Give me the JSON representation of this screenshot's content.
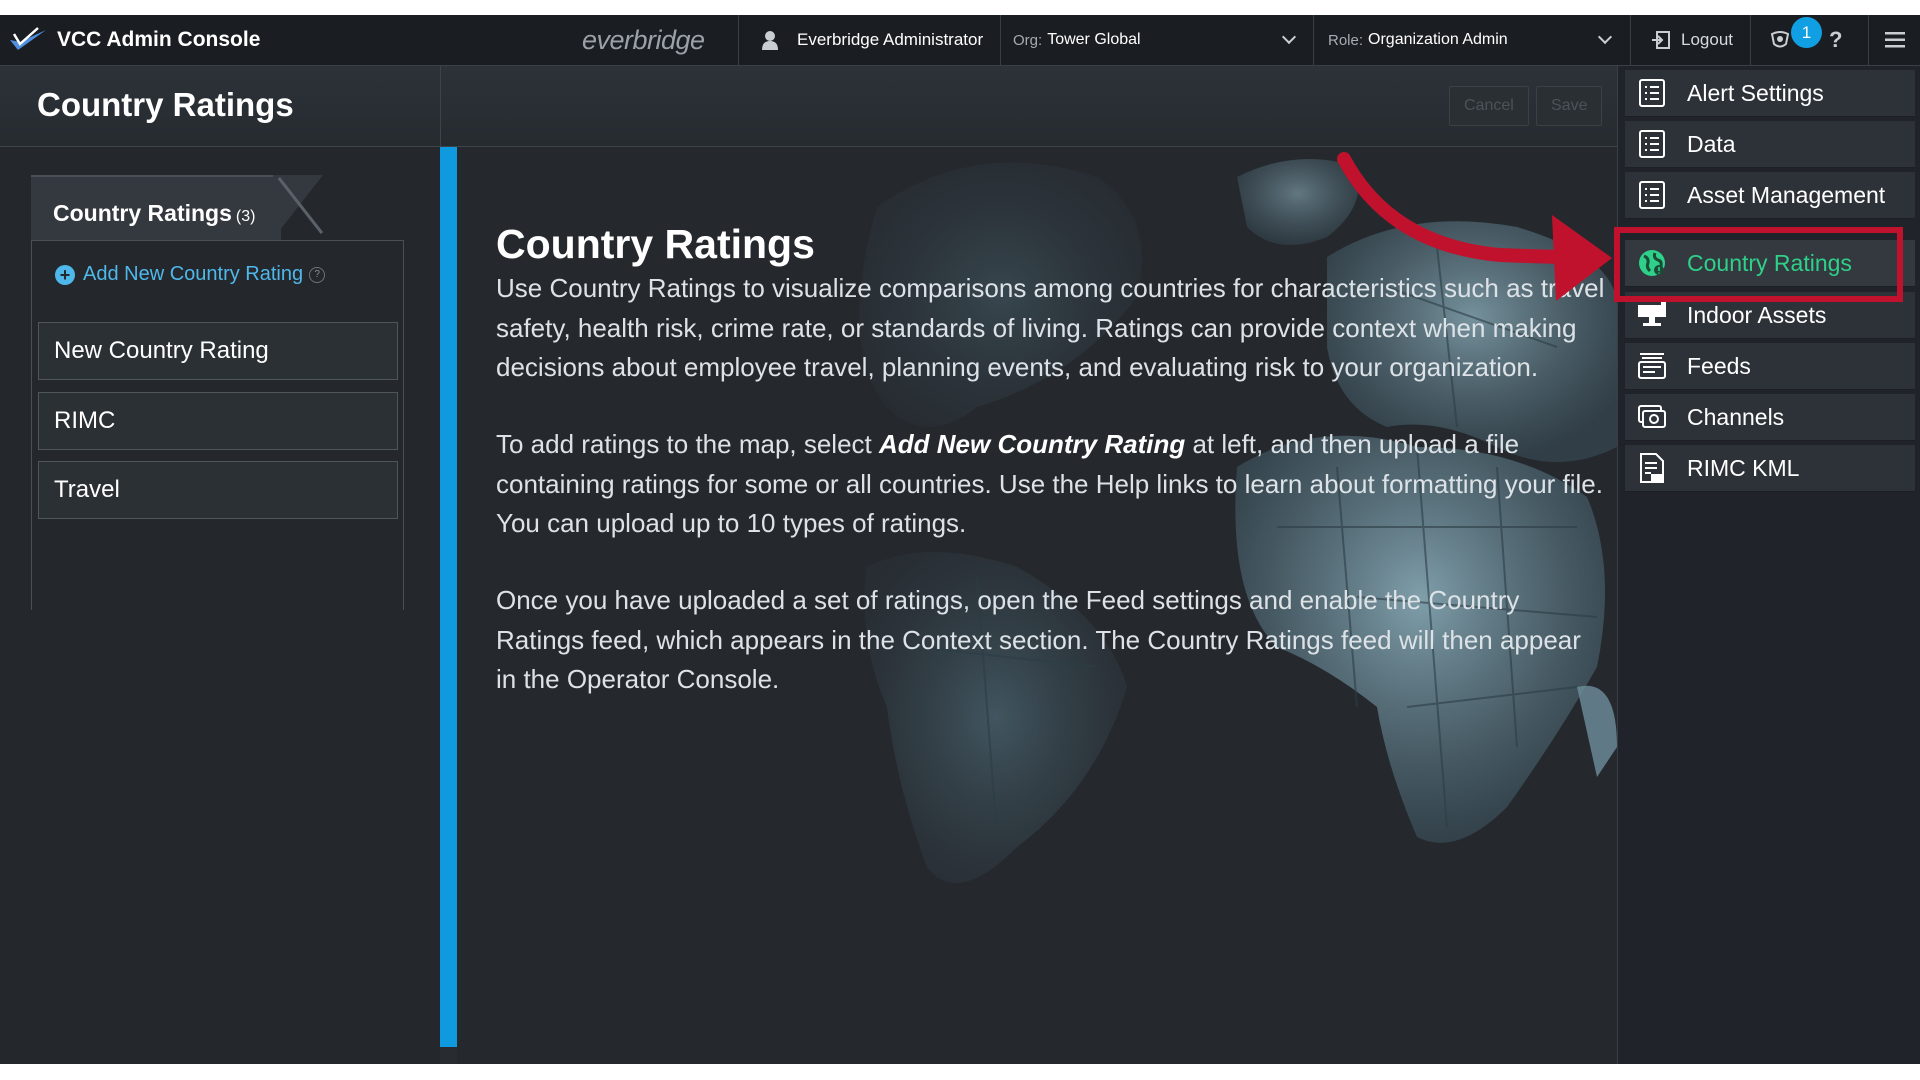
{
  "topbar": {
    "app_title": "VCC Admin Console",
    "brand": "everbridge",
    "user_name": "Everbridge Administrator",
    "org_label": "Org:",
    "org_value": "Tower Global",
    "role_label": "Role:",
    "role_value": "Organization Admin",
    "logout_label": "Logout",
    "notification_count": "1",
    "help_label": "?"
  },
  "header": {
    "title": "Country Ratings",
    "cancel_label": "Cancel",
    "save_label": "Save"
  },
  "sidebar": {
    "tab_title": "Country Ratings",
    "tab_count": "(3)",
    "add_label": "Add New Country Rating",
    "items": [
      {
        "label": "New Country Rating"
      },
      {
        "label": "RIMC"
      },
      {
        "label": "Travel"
      }
    ]
  },
  "content": {
    "title": "Country Ratings",
    "p1": "Use Country Ratings to visualize comparisons among countries for characteristics such as travel safety, health risk, crime rate, or standards of living. Ratings can provide context when making decisions about employee travel, planning events, and evaluating risk to your organization.",
    "p2_pre": "To add ratings to the map, select ",
    "p2_em": "Add New Country Rating",
    "p2_post": " at left, and then upload a file containing ratings for some or all countries. Use the Help links to learn about formatting your file. You can upload up to 10 types of ratings.",
    "p3": "Once you have uploaded a set of ratings, open the Feed settings and enable the Country Ratings feed, which appears in the Context section. The Country Ratings feed will then appear in the Operator Console."
  },
  "menu": {
    "items": [
      {
        "label": "Alert Settings",
        "icon": "list-icon"
      },
      {
        "label": "Data",
        "icon": "list-icon"
      },
      {
        "label": "Asset Management",
        "icon": "list-icon"
      },
      {
        "label": "Country Ratings",
        "icon": "globe-icon",
        "active": true
      },
      {
        "label": "Indoor Assets",
        "icon": "monitor-icon"
      },
      {
        "label": "Feeds",
        "icon": "feed-stack-icon"
      },
      {
        "label": "Channels",
        "icon": "channels-icon"
      },
      {
        "label": "RIMC KML",
        "icon": "kml-file-icon"
      }
    ]
  },
  "colors": {
    "accent_blue": "#0f9ae0",
    "active_green": "#2fd08a",
    "highlight_red": "#c1122d"
  }
}
